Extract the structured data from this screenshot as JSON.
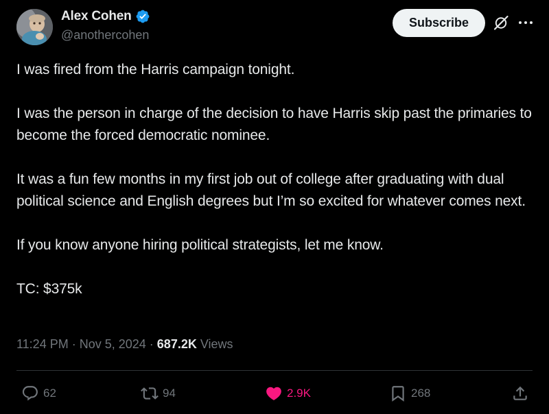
{
  "author": {
    "display_name": "Alex Cohen",
    "handle": "@anothercohen",
    "verified": true,
    "verified_color": "#1d9bf0"
  },
  "header": {
    "subscribe_label": "Subscribe",
    "grok_icon": "grok-icon",
    "more_icon": "more-horizontal-icon"
  },
  "tweet": {
    "paragraphs": [
      "I was fired from the Harris campaign tonight.",
      "I was the person in charge of the decision to have Harris skip past the primaries to become the forced democratic nominee.",
      "It was a fun few months in my first job out of college after graduating with dual political science and English degrees but I’m so excited for whatever comes next.",
      "If you know anyone hiring political strategists, let me know.",
      "TC: $375k"
    ]
  },
  "meta": {
    "time": "11:24 PM",
    "separator": "·",
    "date": "Nov 5, 2024",
    "views_count": "687.2K",
    "views_label": "Views"
  },
  "actions": {
    "reply_count": "62",
    "retweet_count": "94",
    "like_count": "2.9K",
    "bookmark_count": "268",
    "like_color": "#f91880",
    "icons": [
      "reply-icon",
      "retweet-icon",
      "heart-icon",
      "bookmark-icon",
      "share-icon"
    ]
  }
}
